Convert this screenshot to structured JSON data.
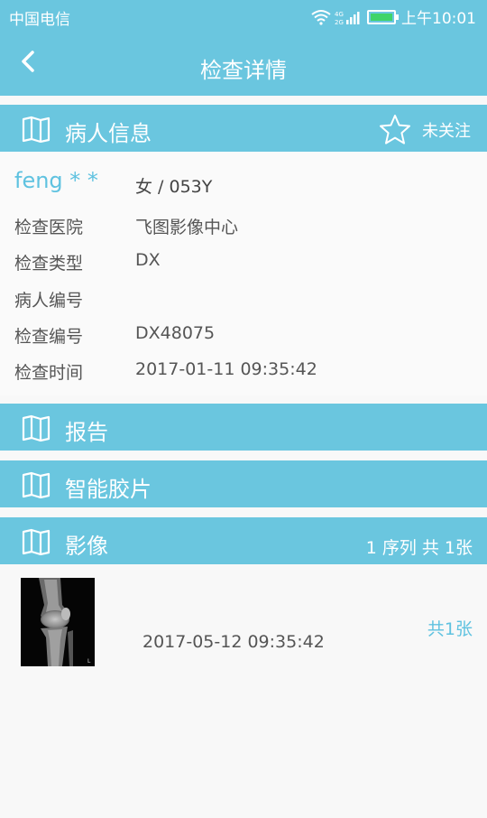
{
  "status": {
    "carrier": "中国电信",
    "network": "4G 2G",
    "time": "上午10:01",
    "accent": "#6ac6df"
  },
  "nav": {
    "title": "检查详情",
    "back_icon": "chevron-left-icon"
  },
  "patient_section": {
    "label": "病人信息",
    "icon": "book-icon",
    "follow": {
      "icon": "star-outline-icon",
      "label": "未关注"
    }
  },
  "patient": {
    "name": "feng * *",
    "gender_age": "女 / 053Y",
    "rows": [
      {
        "label": "检查医院",
        "value": "飞图影像中心"
      },
      {
        "label": "检查类型",
        "value": "DX"
      },
      {
        "label": "病人编号",
        "value": ""
      },
      {
        "label": "检查编号",
        "value": "DX48075"
      },
      {
        "label": "检查时间",
        "value": "2017-01-11 09:35:42"
      }
    ]
  },
  "report_section": {
    "label": "报告",
    "icon": "book-icon"
  },
  "film_section": {
    "label": "智能胶片",
    "icon": "book-icon"
  },
  "image_section": {
    "label": "影像",
    "icon": "book-icon",
    "summary": "1 序列 共 1张"
  },
  "images": [
    {
      "thumbnail": "knee-xray-thumbnail",
      "date": "2017-05-12 09:35:42",
      "count": "共1张"
    }
  ]
}
